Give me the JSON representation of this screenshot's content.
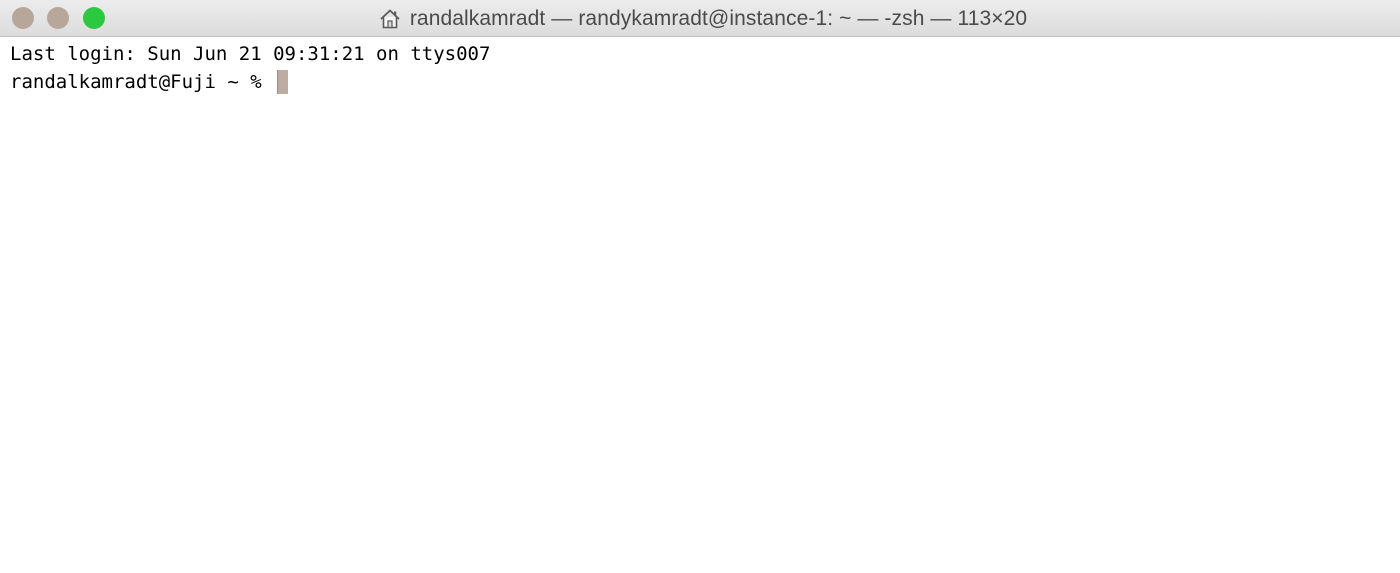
{
  "window": {
    "title": "randalkamradt — randykamradt@instance-1: ~ — -zsh — 113×20",
    "title_icon": "home-icon",
    "controls": [
      {
        "name": "close",
        "color": "#b7a69a"
      },
      {
        "name": "minimize",
        "color": "#b7a69a"
      },
      {
        "name": "zoom",
        "color": "#2ac940"
      }
    ]
  },
  "terminal": {
    "last_login": "Last login: Sun Jun 21 09:31:21 on ttys007",
    "prompt": "randalkamradt@Fuji ~ % ",
    "cursor_color": "#bcaca2"
  }
}
